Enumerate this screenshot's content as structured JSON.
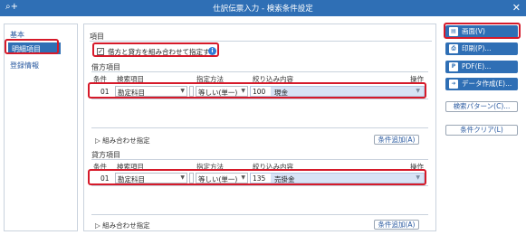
{
  "window": {
    "title": "仕訳伝票入力 - 検索条件設定",
    "app_icon": "search-plus-icon",
    "close_icon": "close-icon"
  },
  "sidebar": {
    "items": [
      {
        "label": "基本",
        "active": false
      },
      {
        "label": "明細項目",
        "active": true
      },
      {
        "label": "登録情報",
        "active": false
      }
    ]
  },
  "main": {
    "section_title": "項目",
    "combine_checkbox": {
      "label": "借方と貸方を組み合わせて指定する",
      "checked": true
    },
    "headers": {
      "condition": "条件",
      "search_item": "検索項目",
      "method": "指定方法",
      "filter": "絞り込み内容",
      "operation": "操作"
    },
    "debit": {
      "title": "借方項目",
      "row": {
        "no": "01",
        "item": "勘定科目",
        "method": "等しい(単一)",
        "code": "100",
        "name": "現金"
      },
      "combo_label": "組み合わせ指定",
      "add_button": "条件追加(A)"
    },
    "credit": {
      "title": "貸方項目",
      "row": {
        "no": "01",
        "item": "勘定科目",
        "method": "等しい(単一)",
        "code": "135",
        "name": "売掛金"
      },
      "combo_label": "組み合わせ指定",
      "add_button": "条件追加(A)"
    }
  },
  "actions": {
    "screen": "画面(V)",
    "print": "印刷(P)...",
    "pdf": "PDF(E)...",
    "data": "データ作成(E)...",
    "search_pattern": "検索パターン(C)...",
    "clear": "条件クリア(L)"
  },
  "colors": {
    "accent": "#2f6fb5",
    "highlight": "#d61a2a",
    "value_fill": "#d7e3f5"
  }
}
